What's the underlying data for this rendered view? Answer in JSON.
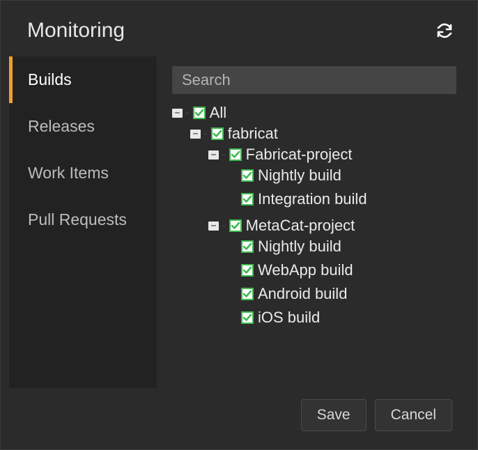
{
  "header": {
    "title": "Monitoring"
  },
  "sidebar": {
    "items": [
      {
        "label": "Builds",
        "active": true
      },
      {
        "label": "Releases",
        "active": false
      },
      {
        "label": "Work Items",
        "active": false
      },
      {
        "label": "Pull Requests",
        "active": false
      }
    ]
  },
  "search": {
    "placeholder": "Search",
    "value": ""
  },
  "tree": {
    "root": {
      "label": "All",
      "checked": true,
      "expanded": true,
      "children": [
        {
          "label": "fabricat",
          "checked": true,
          "expanded": true,
          "children": [
            {
              "label": "Fabricat-project",
              "checked": true,
              "expanded": true,
              "children": [
                {
                  "label": "Nightly build",
                  "checked": true
                },
                {
                  "label": "Integration build",
                  "checked": true
                }
              ]
            },
            {
              "label": "MetaCat-project",
              "checked": true,
              "expanded": true,
              "children": [
                {
                  "label": "Nightly build",
                  "checked": true
                },
                {
                  "label": "WebApp build",
                  "checked": true
                },
                {
                  "label": "Android build",
                  "checked": true
                },
                {
                  "label": "iOS build",
                  "checked": true
                }
              ]
            }
          ]
        }
      ]
    }
  },
  "footer": {
    "save": "Save",
    "cancel": "Cancel"
  },
  "colors": {
    "accent": "#f0a030",
    "check": "#3fb94f"
  }
}
